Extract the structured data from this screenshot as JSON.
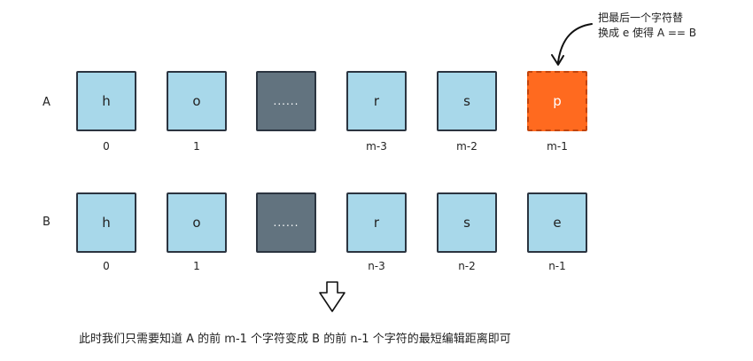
{
  "row_a": {
    "label": "A",
    "cells": [
      "h",
      "o",
      "......",
      "r",
      "s",
      "p"
    ],
    "indices": [
      "0",
      "1",
      "",
      "m-3",
      "m-2",
      "m-1"
    ]
  },
  "row_b": {
    "label": "B",
    "cells": [
      "h",
      "o",
      "......",
      "r",
      "s",
      "e"
    ],
    "indices": [
      "0",
      "1",
      "",
      "n-3",
      "n-2",
      "n-1"
    ]
  },
  "annotation": {
    "line1": "把最后一个字符替",
    "line2": "换成 e 使得 A == B"
  },
  "caption": "此时我们只需要知道 A 的前 m-1 个字符变成 B 的前 n-1 个字符的最短编辑距离即可",
  "colors": {
    "cell": "#a8d8ea",
    "ellipsis_cell": "#62737f",
    "highlight": "#ff6a1f"
  }
}
